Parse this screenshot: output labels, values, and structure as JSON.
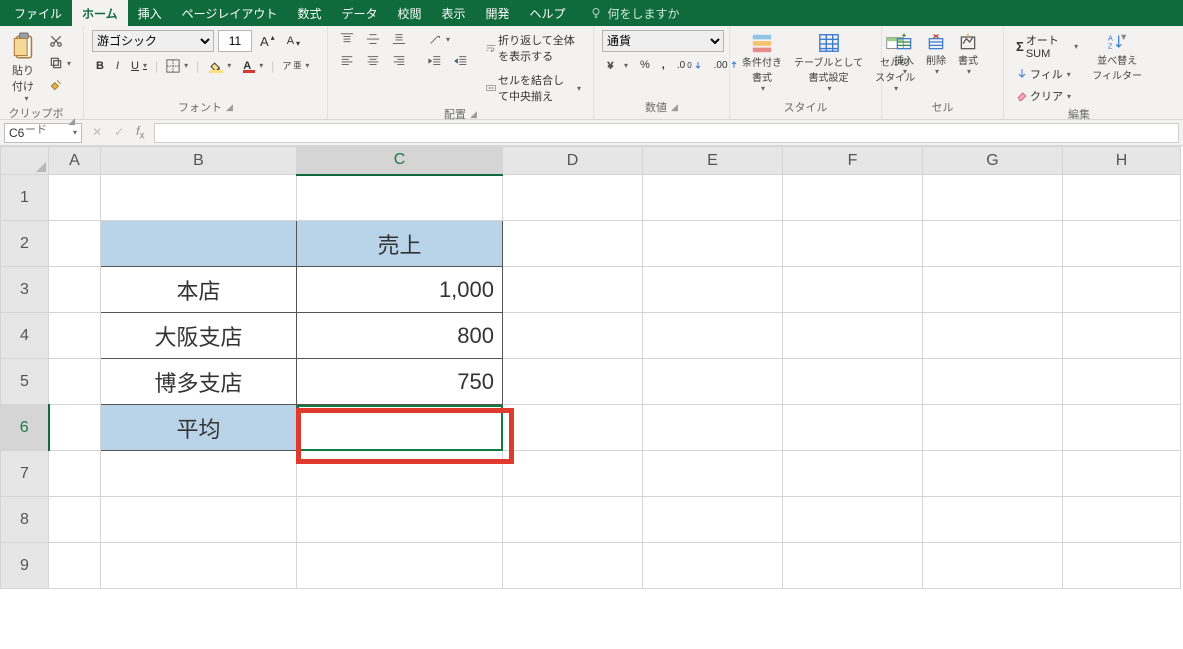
{
  "tabs": {
    "file": "ファイル",
    "home": "ホーム",
    "insert": "挿入",
    "layout": "ページレイアウト",
    "formulas": "数式",
    "data": "データ",
    "review": "校閲",
    "view": "表示",
    "dev": "開発",
    "help": "ヘルプ",
    "tell": "何をしますか"
  },
  "ribbon": {
    "clipboard": {
      "paste": "貼り付け",
      "label": "クリップボード"
    },
    "font": {
      "name": "游ゴシック",
      "size": "11",
      "label": "フォント",
      "increase": "A",
      "decrease": "A",
      "bold": "B",
      "italic": "I",
      "underline": "U"
    },
    "align": {
      "wrap": "折り返して全体を表示する",
      "merge": "セルを結合して中央揃え",
      "label": "配置"
    },
    "number": {
      "format": "通貨",
      "label": "数値"
    },
    "styles": {
      "cond": "条件付き\n書式",
      "table": "テーブルとして\n書式設定",
      "cell": "セルの\nスタイル",
      "label": "スタイル"
    },
    "cells": {
      "insert": "挿入",
      "delete": "削除",
      "format": "書式",
      "label": "セル"
    },
    "editing": {
      "sum": "オート SUM",
      "fill": "フィル",
      "clear": "クリア",
      "sort": "並べ替え\nフィルター",
      "label": "編集"
    }
  },
  "namebox": "C6",
  "formula": "",
  "columns": [
    "A",
    "B",
    "C",
    "D",
    "E",
    "F",
    "G",
    "H"
  ],
  "rows": [
    "1",
    "2",
    "3",
    "4",
    "5",
    "6",
    "7",
    "8",
    "9"
  ],
  "cells": {
    "C2": "売上",
    "B3": "本店",
    "C3": "1,000",
    "B4": "大阪支店",
    "C4": "800",
    "B5": "博多支店",
    "C5": "750",
    "B6": "平均"
  },
  "active_cell": "C6"
}
